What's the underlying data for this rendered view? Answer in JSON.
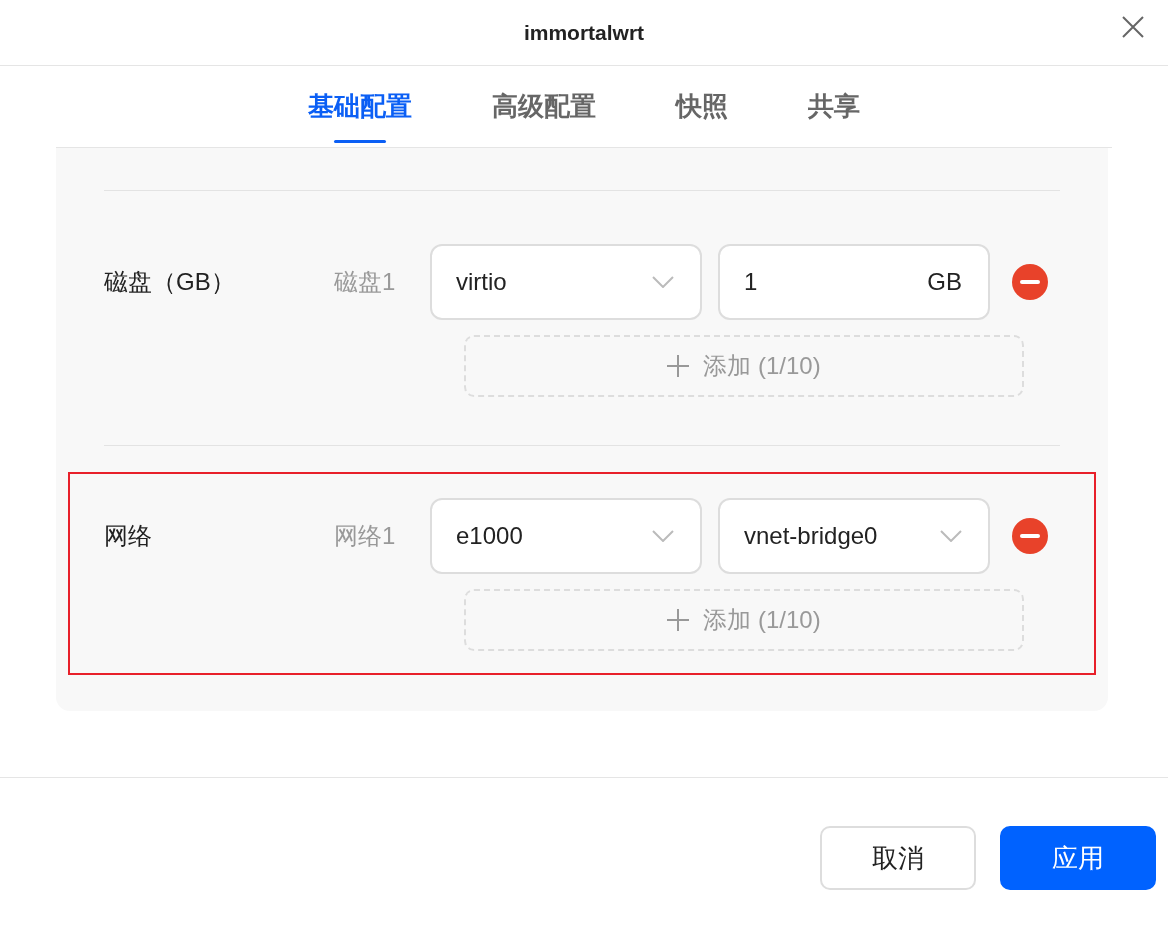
{
  "window": {
    "title": "immortalwrt"
  },
  "tabs": [
    {
      "label": "基础配置",
      "selected": true
    },
    {
      "label": "高级配置",
      "selected": false
    },
    {
      "label": "快照",
      "selected": false
    },
    {
      "label": "共享",
      "selected": false
    }
  ],
  "sections": [
    {
      "label": "磁盘（GB）",
      "highlighted": false,
      "items": [
        {
          "label": "磁盘1",
          "fields": [
            {
              "kind": "select",
              "value": "virtio"
            },
            {
              "kind": "input",
              "value": "1",
              "unit": "GB"
            }
          ]
        }
      ],
      "add_button": "添加 (1/10)"
    },
    {
      "label": "网络",
      "highlighted": true,
      "items": [
        {
          "label": "网络1",
          "fields": [
            {
              "kind": "select",
              "value": "e1000"
            },
            {
              "kind": "select",
              "value": "vnet-bridge0"
            }
          ]
        }
      ],
      "add_button": "添加 (1/10)"
    }
  ],
  "buttons": [
    {
      "label": "取消",
      "kind": "secondary"
    },
    {
      "label": "应用",
      "kind": "primary"
    }
  ]
}
